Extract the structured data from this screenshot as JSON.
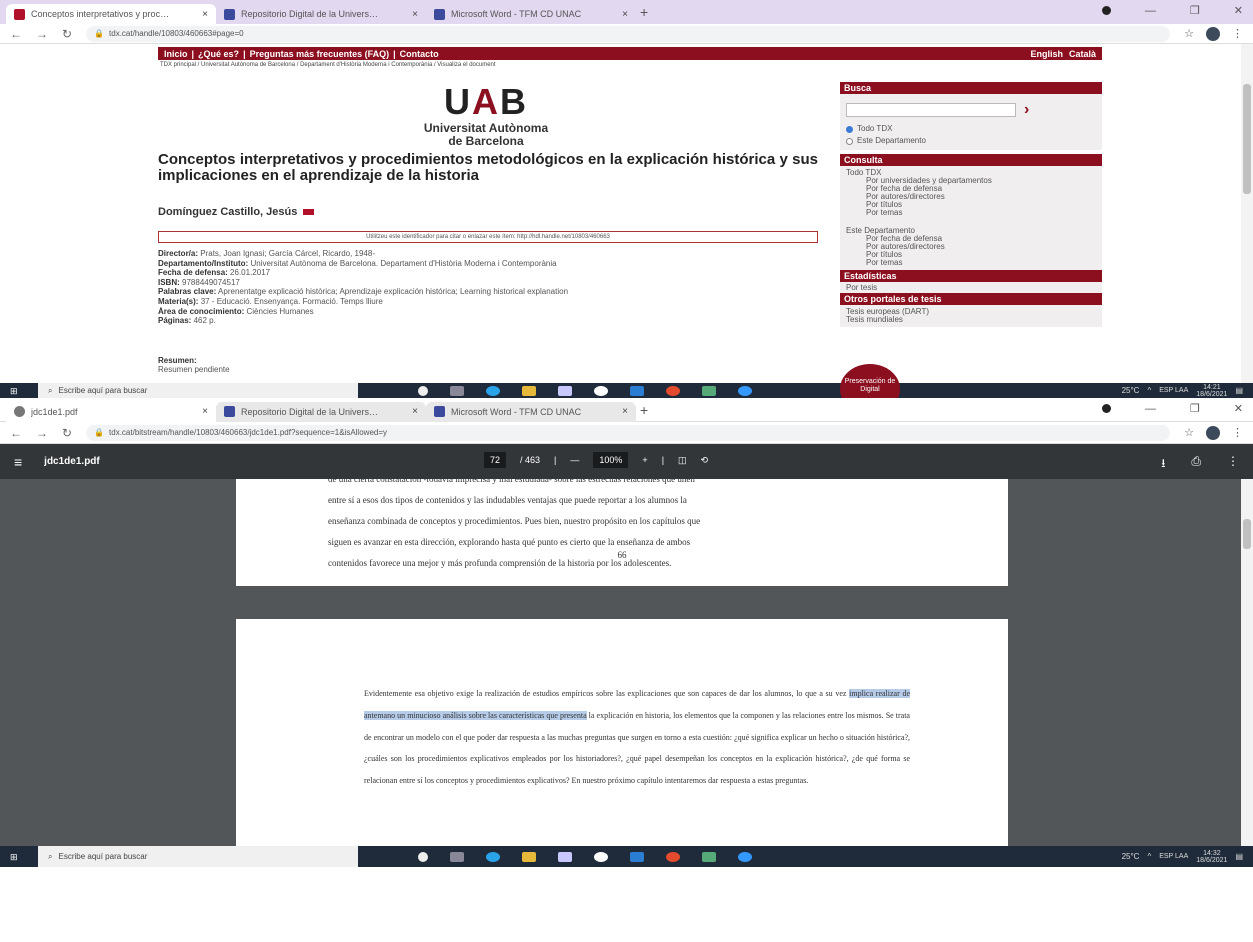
{
  "top_window": {
    "tabs": [
      {
        "title": "Conceptos interpretativos y proc…",
        "active": true
      },
      {
        "title": "Repositorio Digital de la Univers…",
        "active": false
      },
      {
        "title": "Microsoft Word - TFM CD UNAC",
        "active": false
      }
    ],
    "url": "tdx.cat/handle/10803/460663#page=0",
    "site": {
      "menu_left": [
        "Inicio",
        "|",
        "¿Qué es?",
        "|",
        "Preguntas más frecuentes (FAQ)",
        "|",
        "Contacto"
      ],
      "menu_right": [
        "English",
        "Català"
      ],
      "breadcrumb": "TDX principal  /  Universitat Autònoma de Barcelona  /  Departament d'Història Moderna i Contemporània  /  Visualiza el document",
      "logo_main_1": "U",
      "logo_main_2": "A",
      "logo_main_3": "B",
      "logo_line1": "Universitat Autònoma",
      "logo_line2": "de Barcelona",
      "title": "Conceptos interpretativos y procedimientos metodológicos en la explicación histórica y sus implicaciones en el aprendizaje de la historia",
      "author": "Domínguez Castillo, Jesús",
      "handle_note": "Utilitzeu este identificador para citar o enlazar este ítem: http://hdl.handle.net/10803/460663",
      "meta": [
        {
          "label": "Director/a:",
          "value": "Prats, Joan Ignasi; García Cárcel, Ricardo, 1948-"
        },
        {
          "label": "Departamento/Instituto:",
          "value": "Universitat Autònoma de Barcelona. Departament d'Història Moderna i Contemporània"
        },
        {
          "label": "Fecha de defensa:",
          "value": "26.01.2017"
        },
        {
          "label": "ISBN:",
          "value": "9788449074517"
        },
        {
          "label": "Palabras clave:",
          "value": "Aprenentatge explicació històrica; Aprendizaje explicación histórica; Learning historical explanation"
        },
        {
          "label": "Materia(s):",
          "value": "37 - Educació. Ensenyança. Formació. Temps lliure"
        },
        {
          "label": "Área de conocimiento:",
          "value": "Ciències Humanes"
        },
        {
          "label": "Páginas:",
          "value": "462 p."
        }
      ],
      "resumen_label": "Resumen:",
      "resumen_value": "Resumen pendiente",
      "sidebar": {
        "busca": "Busca",
        "radio_all": "Todo TDX",
        "radio_dept": "Este Departamento",
        "consulta": "Consulta",
        "todo_tdx": "Todo TDX",
        "links_all": [
          "Por universidades y departamentos",
          "Por fecha de defensa",
          "Por autores/directores",
          "Por títulos",
          "Por temas"
        ],
        "este_dep": "Este Departamento",
        "links_dept": [
          "Por fecha de defensa",
          "Por autores/directores",
          "Por títulos",
          "Por temas"
        ],
        "estadisticas": "Estadísticas",
        "por_tesis": "Por tesis",
        "otros": "Otros portales de tesis",
        "otros_links": [
          "Tesis europeas (DART)",
          "Tesis mundiales"
        ],
        "badge": "Preservación de Digital"
      }
    },
    "taskbar": {
      "search_placeholder": "Escribe aquí para buscar",
      "temp": "25°C",
      "lang": "ESP LAA",
      "time": "14:21",
      "date": "18/6/2021"
    }
  },
  "bottom_window": {
    "tabs": [
      {
        "title": "jdc1de1.pdf",
        "active": true
      },
      {
        "title": "Repositorio Digital de la Univers…",
        "active": false
      },
      {
        "title": "Microsoft Word - TFM CD UNAC",
        "active": false
      }
    ],
    "url": "tdx.cat/bitstream/handle/10803/460663/jdc1de1.pdf?sequence=1&isAllowed=y",
    "pdf": {
      "filename": "jdc1de1.pdf",
      "page": "72",
      "total": "/ 463",
      "zoom": "100%",
      "page1_lines": [
        "de una cierta constatación -todavía imprecisa y mal estudiada- sobre las estrechas relaciones que unen",
        "entre sí a esos dos tipos de contenidos y las indudables ventajas que puede reportar a los alumnos la",
        "enseñanza combinada de conceptos y procedimientos. Pues bien, nuestro propósito en los capítulos que",
        "siguen es avanzar en esta dirección, explorando hasta qué punto es cierto que la enseñanza de ambos",
        "contenidos favorece una mejor y más profunda comprensión de la historia por los adolescentes."
      ],
      "page1_number": "66",
      "p2_a": "Evidentemente esa objetivo exige la realización de estudios empíricos sobre las explicaciones que son capaces de dar los alumnos, lo que a su vez ",
      "p2_hl": "implica realizar de antemano un minucioso análisis sobre las características que presenta",
      "p2_b": " la explicación en historia, los elementos que la componen y las relaciones entre los mismos. Se trata de encontrar un modelo con el que poder dar respuesta a las muchas preguntas que surgen en torno a esta cuestión: ¿qué significa explicar un hecho o situación histórica?, ¿cuáles son los procedimientos explicativos empleados por los historiadores?, ¿qué papel desempeñan los conceptos en la explicación histórica?, ¿de qué forma se relacionan entre sí los conceptos y procedimientos explicativos? En nuestro próximo capítulo intentaremos dar respuesta a estas preguntas."
    },
    "taskbar": {
      "search_placeholder": "Escribe aquí para buscar",
      "temp": "25°C",
      "lang": "ESP LAA",
      "time": "14:32",
      "date": "18/6/2021"
    }
  }
}
